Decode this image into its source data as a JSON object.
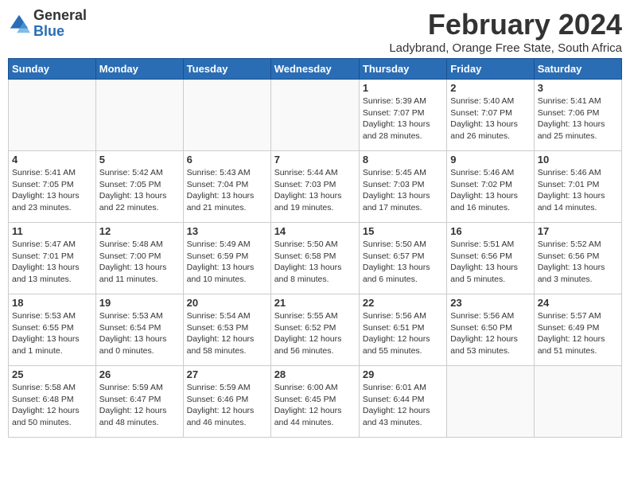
{
  "logo": {
    "general": "General",
    "blue": "Blue"
  },
  "title": "February 2024",
  "subtitle": "Ladybrand, Orange Free State, South Africa",
  "days_of_week": [
    "Sunday",
    "Monday",
    "Tuesday",
    "Wednesday",
    "Thursday",
    "Friday",
    "Saturday"
  ],
  "weeks": [
    [
      {
        "day": "",
        "info": ""
      },
      {
        "day": "",
        "info": ""
      },
      {
        "day": "",
        "info": ""
      },
      {
        "day": "",
        "info": ""
      },
      {
        "day": "1",
        "info": "Sunrise: 5:39 AM\nSunset: 7:07 PM\nDaylight: 13 hours\nand 28 minutes."
      },
      {
        "day": "2",
        "info": "Sunrise: 5:40 AM\nSunset: 7:07 PM\nDaylight: 13 hours\nand 26 minutes."
      },
      {
        "day": "3",
        "info": "Sunrise: 5:41 AM\nSunset: 7:06 PM\nDaylight: 13 hours\nand 25 minutes."
      }
    ],
    [
      {
        "day": "4",
        "info": "Sunrise: 5:41 AM\nSunset: 7:05 PM\nDaylight: 13 hours\nand 23 minutes."
      },
      {
        "day": "5",
        "info": "Sunrise: 5:42 AM\nSunset: 7:05 PM\nDaylight: 13 hours\nand 22 minutes."
      },
      {
        "day": "6",
        "info": "Sunrise: 5:43 AM\nSunset: 7:04 PM\nDaylight: 13 hours\nand 21 minutes."
      },
      {
        "day": "7",
        "info": "Sunrise: 5:44 AM\nSunset: 7:03 PM\nDaylight: 13 hours\nand 19 minutes."
      },
      {
        "day": "8",
        "info": "Sunrise: 5:45 AM\nSunset: 7:03 PM\nDaylight: 13 hours\nand 17 minutes."
      },
      {
        "day": "9",
        "info": "Sunrise: 5:46 AM\nSunset: 7:02 PM\nDaylight: 13 hours\nand 16 minutes."
      },
      {
        "day": "10",
        "info": "Sunrise: 5:46 AM\nSunset: 7:01 PM\nDaylight: 13 hours\nand 14 minutes."
      }
    ],
    [
      {
        "day": "11",
        "info": "Sunrise: 5:47 AM\nSunset: 7:01 PM\nDaylight: 13 hours\nand 13 minutes."
      },
      {
        "day": "12",
        "info": "Sunrise: 5:48 AM\nSunset: 7:00 PM\nDaylight: 13 hours\nand 11 minutes."
      },
      {
        "day": "13",
        "info": "Sunrise: 5:49 AM\nSunset: 6:59 PM\nDaylight: 13 hours\nand 10 minutes."
      },
      {
        "day": "14",
        "info": "Sunrise: 5:50 AM\nSunset: 6:58 PM\nDaylight: 13 hours\nand 8 minutes."
      },
      {
        "day": "15",
        "info": "Sunrise: 5:50 AM\nSunset: 6:57 PM\nDaylight: 13 hours\nand 6 minutes."
      },
      {
        "day": "16",
        "info": "Sunrise: 5:51 AM\nSunset: 6:56 PM\nDaylight: 13 hours\nand 5 minutes."
      },
      {
        "day": "17",
        "info": "Sunrise: 5:52 AM\nSunset: 6:56 PM\nDaylight: 13 hours\nand 3 minutes."
      }
    ],
    [
      {
        "day": "18",
        "info": "Sunrise: 5:53 AM\nSunset: 6:55 PM\nDaylight: 13 hours\nand 1 minute."
      },
      {
        "day": "19",
        "info": "Sunrise: 5:53 AM\nSunset: 6:54 PM\nDaylight: 13 hours\nand 0 minutes."
      },
      {
        "day": "20",
        "info": "Sunrise: 5:54 AM\nSunset: 6:53 PM\nDaylight: 12 hours\nand 58 minutes."
      },
      {
        "day": "21",
        "info": "Sunrise: 5:55 AM\nSunset: 6:52 PM\nDaylight: 12 hours\nand 56 minutes."
      },
      {
        "day": "22",
        "info": "Sunrise: 5:56 AM\nSunset: 6:51 PM\nDaylight: 12 hours\nand 55 minutes."
      },
      {
        "day": "23",
        "info": "Sunrise: 5:56 AM\nSunset: 6:50 PM\nDaylight: 12 hours\nand 53 minutes."
      },
      {
        "day": "24",
        "info": "Sunrise: 5:57 AM\nSunset: 6:49 PM\nDaylight: 12 hours\nand 51 minutes."
      }
    ],
    [
      {
        "day": "25",
        "info": "Sunrise: 5:58 AM\nSunset: 6:48 PM\nDaylight: 12 hours\nand 50 minutes."
      },
      {
        "day": "26",
        "info": "Sunrise: 5:59 AM\nSunset: 6:47 PM\nDaylight: 12 hours\nand 48 minutes."
      },
      {
        "day": "27",
        "info": "Sunrise: 5:59 AM\nSunset: 6:46 PM\nDaylight: 12 hours\nand 46 minutes."
      },
      {
        "day": "28",
        "info": "Sunrise: 6:00 AM\nSunset: 6:45 PM\nDaylight: 12 hours\nand 44 minutes."
      },
      {
        "day": "29",
        "info": "Sunrise: 6:01 AM\nSunset: 6:44 PM\nDaylight: 12 hours\nand 43 minutes."
      },
      {
        "day": "",
        "info": ""
      },
      {
        "day": "",
        "info": ""
      }
    ]
  ]
}
